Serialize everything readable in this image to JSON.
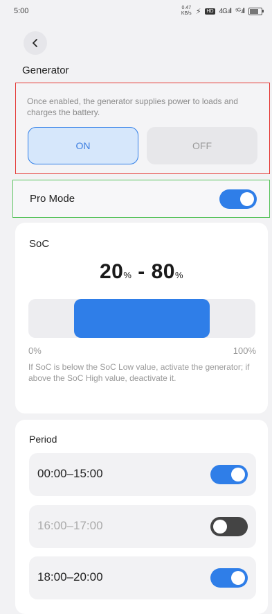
{
  "status_bar": {
    "time": "5:00",
    "net_speed": "0.47\nKB/s",
    "badge": "HD",
    "signal1": "4G.ıll",
    "signal2": "⁵ᴳ.ıll"
  },
  "header": {
    "back_icon": "chevron-left-icon",
    "title": "Generator"
  },
  "generator": {
    "description": "Once enabled, the generator supplies power to loads and charges the battery.",
    "on_label": "ON",
    "off_label": "OFF",
    "selected": "ON"
  },
  "pro_mode": {
    "label": "Pro Mode",
    "enabled": true
  },
  "soc": {
    "title": "SoC",
    "low": "20",
    "high": "80",
    "unit": "%",
    "dash": " - ",
    "range_low_fraction": 0.2,
    "range_high_fraction": 0.8,
    "min_label": "0%",
    "max_label": "100%",
    "note": "If SoC is below the SoC Low value, activate the generator; if above the SoC High value, deactivate it."
  },
  "period": {
    "title": "Period",
    "items": [
      {
        "time": "00:00–15:00",
        "enabled": true
      },
      {
        "time": "16:00–17:00",
        "enabled": false
      },
      {
        "time": "18:00–20:00",
        "enabled": true
      }
    ]
  },
  "colors": {
    "accent": "#2f7ee8",
    "highlight_red": "#e53935",
    "highlight_green": "#5cc460"
  }
}
